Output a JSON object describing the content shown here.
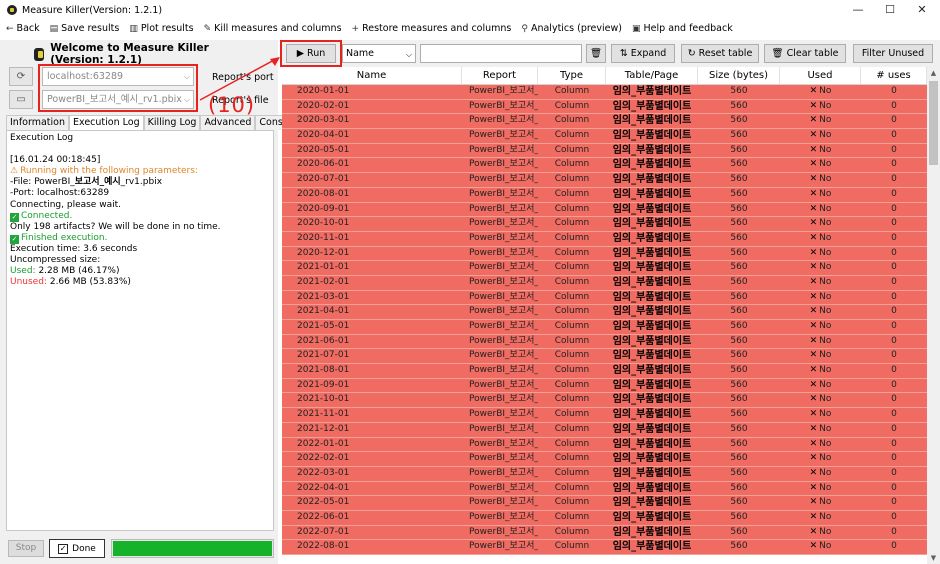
{
  "window": {
    "title": "Measure Killer(Version: 1.2.1)"
  },
  "menu": [
    {
      "icon": "back-arrow-icon",
      "glyph": "←",
      "label": "Back"
    },
    {
      "icon": "save-icon",
      "glyph": "▤",
      "label": "Save results"
    },
    {
      "icon": "plot-icon",
      "glyph": "▥",
      "label": "Plot results"
    },
    {
      "icon": "knife-icon",
      "glyph": "✎",
      "label": "Kill measures and columns"
    },
    {
      "icon": "plus-icon",
      "glyph": "+",
      "label": "Restore measures and columns"
    },
    {
      "icon": "magnifier-icon",
      "glyph": "⚲",
      "label": "Analytics (preview)"
    },
    {
      "icon": "help-icon",
      "glyph": "▣",
      "label": "Help and feedback"
    }
  ],
  "left": {
    "welcome": "Welcome to Measure Killer (Version: 1.2.1)",
    "port_value": "localhost:63289",
    "port_label": "Report's port",
    "file_value": "PowerBI_보고서_예시_rv1.pbix",
    "file_label": "Report's file",
    "annotation": "(10)",
    "tabs": [
      "Information",
      "Execution Log",
      "Killing Log",
      "Advanced",
      "Console"
    ],
    "log_header": "Execution Log",
    "log": {
      "timestamp": "[16.01.24 00:18:45]",
      "running": "Running with the following parameters:",
      "file_prefix": "-File: PowerBI_",
      "file_bold": "보고서_예시",
      "file_suffix": "_rv1.pbix",
      "port": "-Port: localhost:63289",
      "connecting": "Connecting, please wait.",
      "connected": "Connected.",
      "artifacts": "Only 198 artifacts? We will be done in no time.",
      "finished": "Finished execution.",
      "exec_time": "Execution time: 3.6 seconds",
      "uncompressed": "Uncompressed size:",
      "used_label": "Used:",
      "used_value": "2.28 MB (46.17%)",
      "unused_label": "Unused:",
      "unused_value": "2.66 MB (53.83%)"
    },
    "stop_label": "Stop",
    "done_label": "Done",
    "progress": 1.0
  },
  "toolbar": {
    "run_label": "Run",
    "name_select": "Name",
    "search_value": "",
    "expand_label": "Expand",
    "reset_label": "Reset table",
    "clear_label": "Clear table",
    "filter_label": "Filter Unused"
  },
  "table": {
    "columns": [
      "Name",
      "Report",
      "Type",
      "Table/Page",
      "Size (bytes)",
      "Used",
      "# uses"
    ],
    "row_template": {
      "report": "PowerBI_보고서_(",
      "type": "Column",
      "table": "임의_부품별데이트",
      "size": "560",
      "used": "No",
      "uses": "0"
    },
    "names": [
      "2020-01-01",
      "2020-02-01",
      "2020-03-01",
      "2020-04-01",
      "2020-05-01",
      "2020-06-01",
      "2020-07-01",
      "2020-08-01",
      "2020-09-01",
      "2020-10-01",
      "2020-11-01",
      "2020-12-01",
      "2021-01-01",
      "2021-02-01",
      "2021-03-01",
      "2021-04-01",
      "2021-05-01",
      "2021-06-01",
      "2021-07-01",
      "2021-08-01",
      "2021-09-01",
      "2021-10-01",
      "2021-11-01",
      "2021-12-01",
      "2022-01-01",
      "2022-02-01",
      "2022-03-01",
      "2022-04-01",
      "2022-05-01",
      "2022-06-01",
      "2022-07-01",
      "2022-08-01"
    ],
    "row_color": "#f06c62"
  }
}
